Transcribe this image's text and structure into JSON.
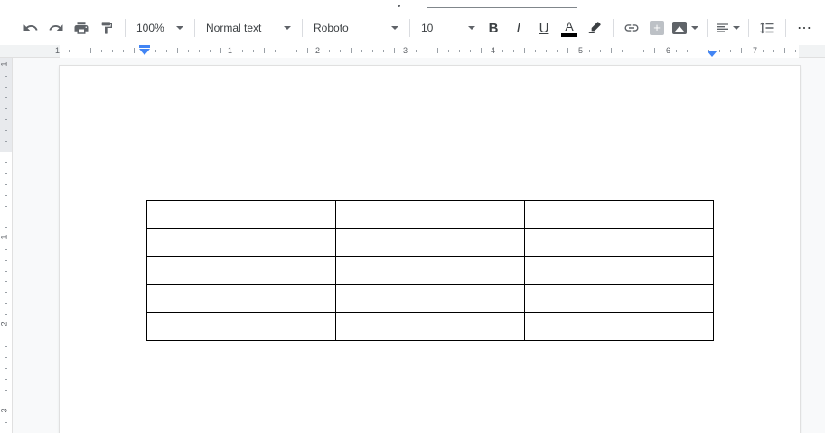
{
  "toolbar": {
    "zoom": "100%",
    "style": "Normal text",
    "font": "Roboto",
    "size": "10",
    "bold": "B",
    "italic": "I",
    "underline": "U",
    "text_color": "A",
    "more": "⋯"
  },
  "ruler": {
    "h_numbers": [
      "1",
      "1",
      "2",
      "3",
      "4",
      "5",
      "6",
      "7"
    ],
    "v_numbers": [
      "1",
      "1",
      "2",
      "3"
    ]
  },
  "table": {
    "rows": 5,
    "cols": 3,
    "cells": [
      [
        "",
        "",
        ""
      ],
      [
        "",
        "",
        ""
      ],
      [
        "",
        "",
        ""
      ],
      [
        "",
        "",
        ""
      ],
      [
        "",
        "",
        ""
      ]
    ]
  },
  "colors": {
    "accent": "#4285f4",
    "icon": "#5f6368",
    "text": "#3c4043"
  }
}
